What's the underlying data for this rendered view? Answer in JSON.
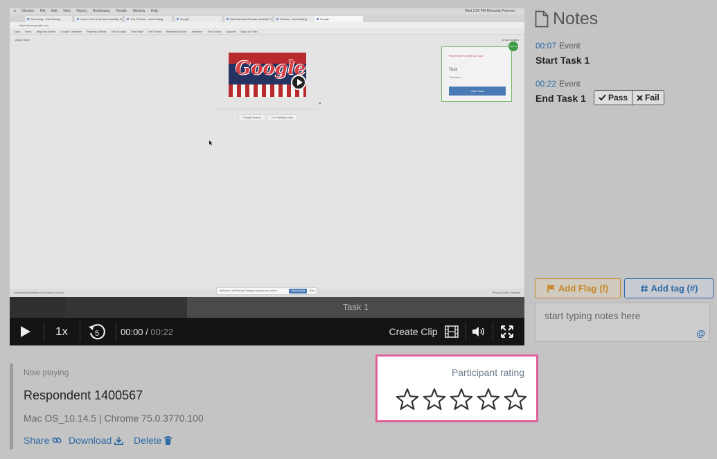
{
  "recording": {
    "menubar": [
      "Chrome",
      "File",
      "Edit",
      "View",
      "History",
      "Bookmarks",
      "People",
      "Window",
      "Help"
    ],
    "status_right": "Wed 2:50 PM  Michaela Peterson",
    "tabs": [
      "Recording - UserTesting",
      "How to Run a Remote Usability Test",
      "Test Preview - UserTesting",
      "Google",
      "Unmoderated Remote Usability Testing",
      "Preview - UserTesting",
      "Google"
    ],
    "url": "https://www.google.com",
    "bookmarks": [
      "Apps",
      "Work",
      "Mapping Admin",
      "Google Translate",
      "Property Details",
      "Test Google",
      "Test Page",
      "Test Flows",
      "Recruiting Board",
      "Analytics",
      "Dev Toolkit",
      "Support",
      "Sign-up Form"
    ],
    "top_left": "About   Store",
    "top_right": "Gmail   Images",
    "google_buttons": [
      "Google Search",
      "I'm Feeling Lucky"
    ],
    "task_card": {
      "reminder": "Remember to think out loud",
      "title": "Task",
      "subtitle": "This task 1",
      "button": "Start Task",
      "badge": "Step 1/1"
    },
    "footer_left": "Advertising    Business    How Search works",
    "footer_right": "Privacy    Terms    Settings",
    "toast": {
      "text": "Welcome, UserTesting! Testing is starting your review",
      "button": "Stop sharing",
      "secondary": "Hide"
    }
  },
  "timeline": {
    "task_label": "Task 1"
  },
  "controls": {
    "speed": "1x",
    "rewind_seconds": "5",
    "current_time": "00:00",
    "separator": " / ",
    "total_time": "00:22",
    "create_clip": "Create Clip"
  },
  "notes": {
    "title": "Notes",
    "entries": [
      {
        "time": "00:07",
        "kind": "Event",
        "title": "Start Task 1"
      },
      {
        "time": "00:22",
        "kind": "Event",
        "title": "End Task 1"
      }
    ],
    "pass_label": "Pass",
    "fail_label": "Fail",
    "add_flag": "Add Flag (f)",
    "add_tag": "Add tag (#)",
    "input_placeholder": "start typing notes here",
    "mention_symbol": "@"
  },
  "now_playing": {
    "label": "Now playing",
    "name": "Respondent 1400567",
    "meta": "Mac OS_10.14.5 | Chrome 75.0.3770.100",
    "share": "Share",
    "download": "Download",
    "delete": "Delete"
  },
  "rating": {
    "label": "Participant rating",
    "max_stars": 5,
    "value": 0
  },
  "colors": {
    "accent_blue": "#2e6aa6",
    "flag_orange": "#c8872a",
    "rating_border": "#e0609a"
  }
}
